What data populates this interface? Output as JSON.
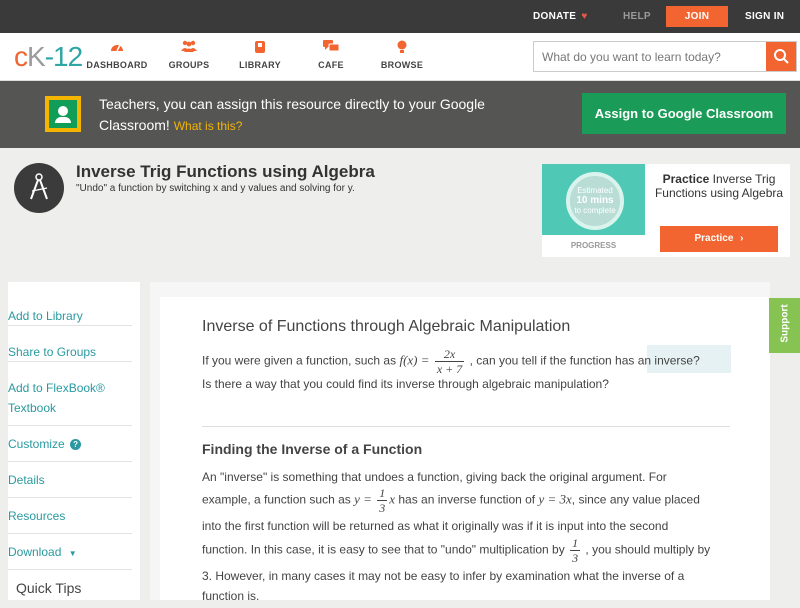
{
  "topbar": {
    "donate": "DONATE",
    "help": "HELP",
    "join": "JOIN",
    "signin": "SIGN IN"
  },
  "logo": {
    "part1": "c",
    "part2": "K",
    "part3": "-12"
  },
  "nav": [
    {
      "label": "DASHBOARD",
      "icon": "dashboard-icon"
    },
    {
      "label": "GROUPS",
      "icon": "groups-icon"
    },
    {
      "label": "LIBRARY",
      "icon": "library-icon"
    },
    {
      "label": "CAFE",
      "icon": "cafe-icon"
    },
    {
      "label": "BROWSE",
      "icon": "browse-icon"
    }
  ],
  "search": {
    "placeholder": "What do you want to learn today?"
  },
  "gc_banner": {
    "text": "Teachers, you can assign this resource directly to your Google Classroom!",
    "what": "What is this?",
    "button": "Assign to Google Classroom"
  },
  "concept": {
    "title": "Inverse Trig Functions using Algebra",
    "subtitle": "\"Undo\" a function by switching x and y values and solving for y."
  },
  "practice": {
    "estimated": "Estimated",
    "mins": "10 mins",
    "to_complete": "to complete",
    "progress": "PROGRESS",
    "title_bold": "Practice",
    "title_rest": "Inverse Trig Functions using Algebra",
    "button": "Practice"
  },
  "sidebar": {
    "items": [
      "Add to Library",
      "Share to Groups",
      "Add to FlexBook® Textbook",
      "Customize",
      "Details",
      "Resources",
      "Download"
    ],
    "quick_tips": "Quick Tips"
  },
  "content": {
    "heading": "Inverse of Functions through Algebraic Manipulation",
    "intro_a": "If you were given a function, such as",
    "intro_fx": "f(x) =",
    "intro_num": "2x",
    "intro_den": "x + 7",
    "intro_b": ", can you tell if the function has an inverse?",
    "intro_c": "Is there a way that you could find its inverse through algebraic manipulation?",
    "subheading": "Finding the Inverse of a Function",
    "p1": "An \"inverse\" is something that undoes a function, giving back the original argument. For",
    "p2a": "example, a function such as",
    "p2_y": "y =",
    "p2_num": "1",
    "p2_den": "3",
    "p2_x": "x",
    "p2b": "has an inverse function of",
    "p2_inv": "y = 3x",
    "p2c": ", since any value placed",
    "p3": "into the first function will be returned as what it originally was if it is input into the second",
    "p4a": "function. In this case, it is easy to see that to \"undo\" multiplication by",
    "p4_num": "1",
    "p4_den": "3",
    "p4b": ", you should multiply by",
    "p5": "3. However, in many cases it may not be easy to infer by examination what the inverse of a",
    "p6": "function is."
  },
  "support": {
    "label": "Support"
  },
  "colors": {
    "accent": "#f26531",
    "teal": "#2a9aa0",
    "google_green": "#1a9b57",
    "support_green": "#86c352"
  }
}
